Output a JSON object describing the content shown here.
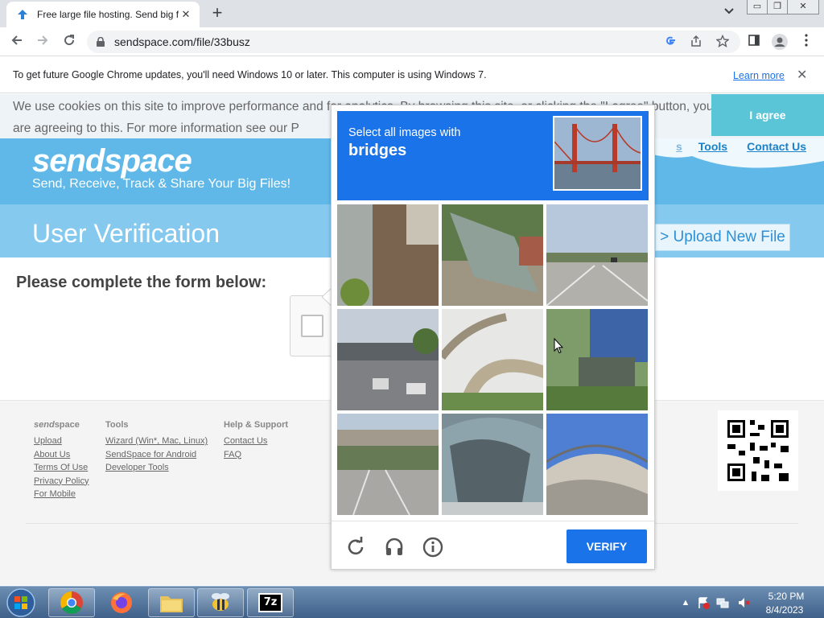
{
  "browser": {
    "tab_title": "Free large file hosting. Send big f",
    "tab_close": "✕",
    "new_tab": "+",
    "url": "sendspace.com/file/33busz",
    "window_controls": {
      "minimize": "▭",
      "restore": "❐",
      "close": "✕"
    }
  },
  "infobar": {
    "message": "To get future Google Chrome updates, you'll need Windows 10 or later. This computer is using Windows 7.",
    "link": "Learn more",
    "close": "✕"
  },
  "page": {
    "cookie_text": "We use cookies on this site to improve performance and for analytics. By browsing this site, or clicking the \"I agree\" button, you are agreeing to this. For more information see our P",
    "agree_label": "I agree",
    "logo": "sendspace",
    "tagline": "Send, Receive, Track & Share Your Big Files!",
    "nav": {
      "partial": "s",
      "tools": "Tools",
      "contact": "Contact Us"
    },
    "hero_title": "User Verification",
    "upload_button": "> Upload New File",
    "form_heading": "Please complete the form below:"
  },
  "footer": {
    "col1": {
      "heading_a": "send",
      "heading_b": "space",
      "links": [
        "Upload",
        "About Us",
        "Terms Of Use",
        "Privacy Policy",
        "For Mobile"
      ]
    },
    "col2": {
      "heading": "Tools",
      "links": [
        "Wizard (Win*, Mac, Linux)",
        "SendSpace for Android",
        "Developer Tools"
      ]
    },
    "col3": {
      "heading": "Help & Support",
      "links": [
        "Contact Us",
        "FAQ"
      ]
    }
  },
  "captcha": {
    "instruction": "Select all images with",
    "target": "bridges",
    "verify_label": "VERIFY",
    "tiles": [
      "building-corner",
      "fallen-glass-panel",
      "highway-road",
      "overpass-highway",
      "curved-overpass",
      "highway-sign",
      "road-overpass",
      "car-window",
      "bridge-railing"
    ]
  },
  "taskbar": {
    "apps": [
      "chrome",
      "firefox",
      "file-explorer",
      "bee-app",
      "7-zip"
    ],
    "zip_label": "7z",
    "time": "5:20 PM",
    "date": "8/4/2023"
  }
}
